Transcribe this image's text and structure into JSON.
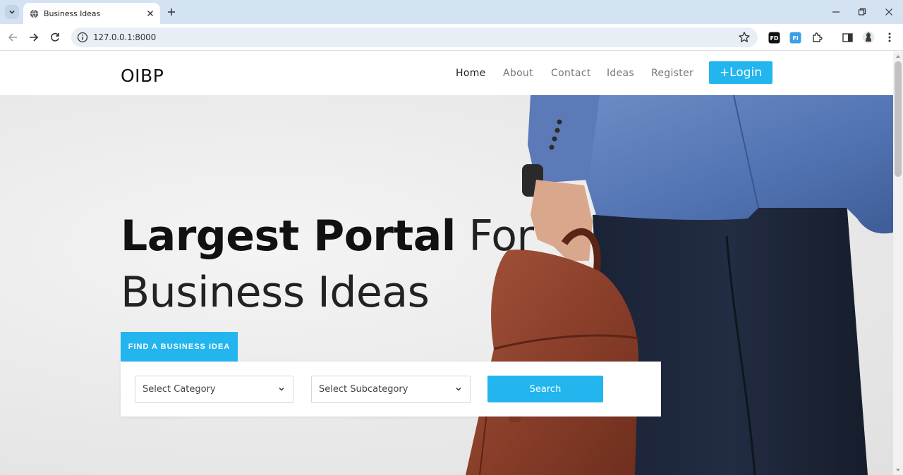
{
  "browser": {
    "tab_title": "Business Ideas",
    "url": "127.0.0.1:8000"
  },
  "site": {
    "brand": "OIBP",
    "nav": [
      {
        "label": "Home"
      },
      {
        "label": "About"
      },
      {
        "label": "Contact"
      },
      {
        "label": "Ideas"
      },
      {
        "label": "Register"
      }
    ],
    "login_label": "+Login"
  },
  "hero": {
    "title_bold": "Largest Portal",
    "title_light": " For",
    "title_line2": "Business Ideas",
    "find_tab_label": "FIND A BUSINESS IDEA",
    "category_placeholder": "Select Category",
    "subcategory_placeholder": "Select Subcategory",
    "search_label": "Search"
  },
  "colors": {
    "accent": "#22b5ee",
    "chrome_tabstrip": "#d3e3f2"
  },
  "icons": {
    "tab_favicon": "globe-icon",
    "extensions": [
      "fd-extension-icon",
      "fi-extension-icon",
      "puzzle-icon",
      "side-panel-icon",
      "profile-avatar-icon",
      "kebab-menu-icon"
    ]
  }
}
